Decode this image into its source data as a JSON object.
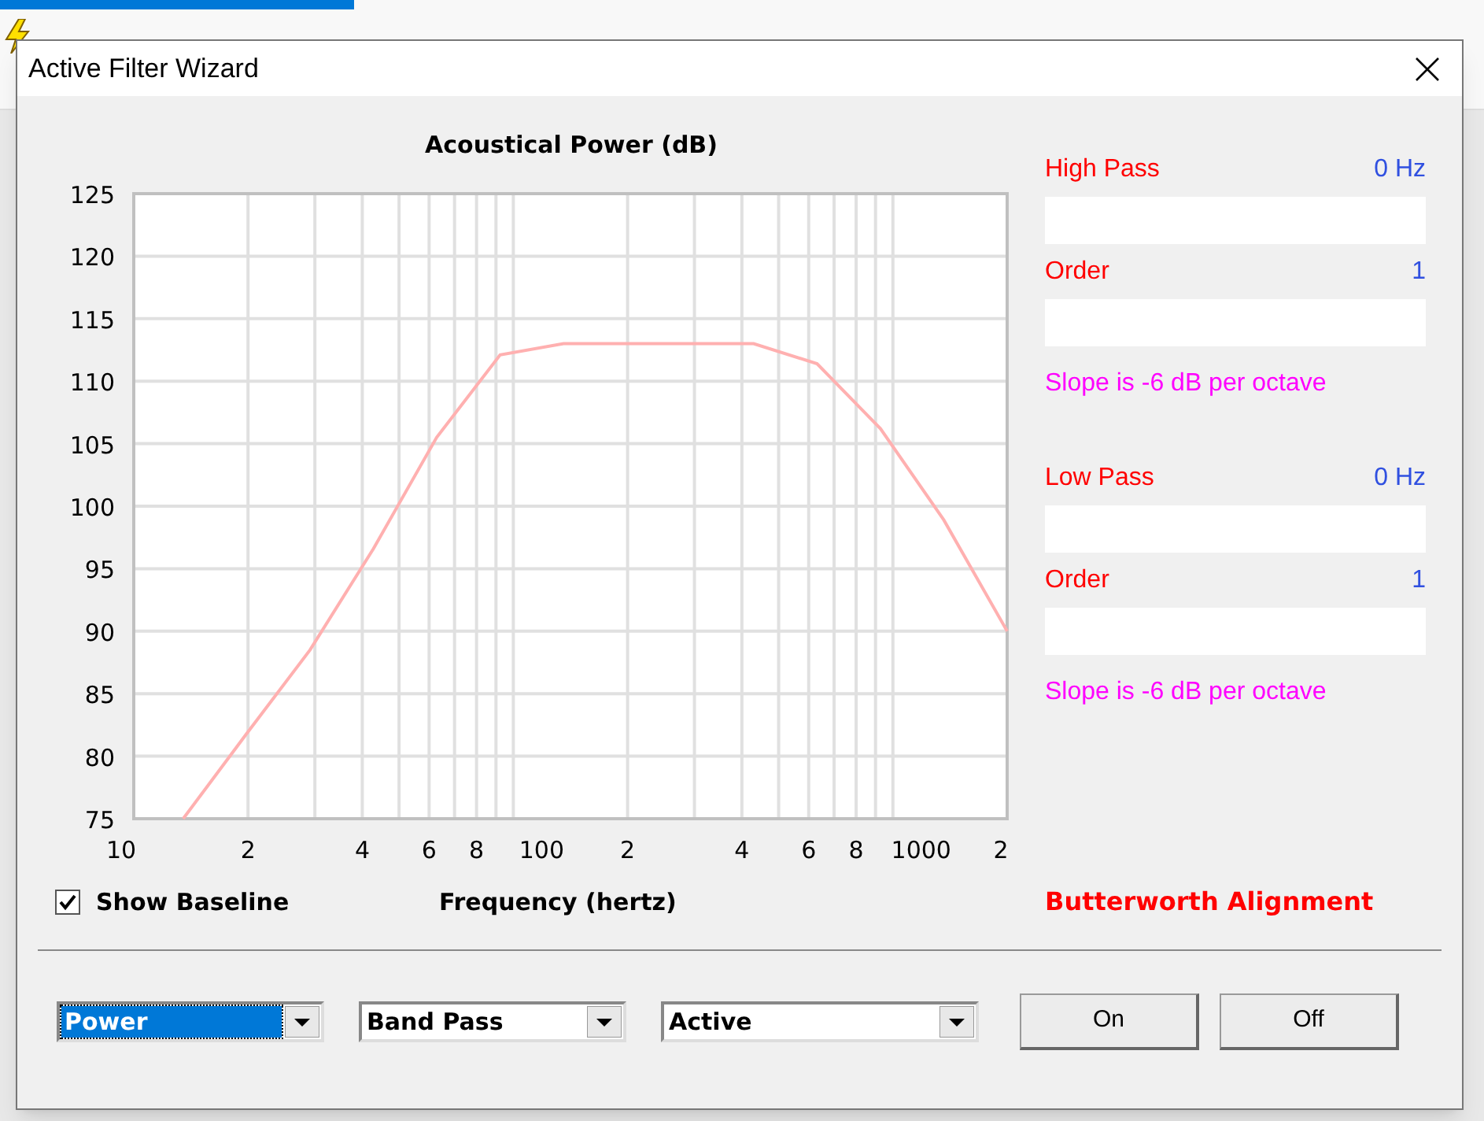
{
  "window": {
    "title": "Active Filter Wizard"
  },
  "chart": {
    "chart_data": {
      "type": "line",
      "title": "Acoustical Power (dB)",
      "xlabel": "Frequency (hertz)",
      "ylim": [
        75,
        125
      ],
      "grid": true,
      "yticks": [
        {
          "value": 75,
          "label": "75"
        },
        {
          "value": 80,
          "label": "80"
        },
        {
          "value": 85,
          "label": "85"
        },
        {
          "value": 90,
          "label": "90"
        },
        {
          "value": 95,
          "label": "95"
        },
        {
          "value": 100,
          "label": "100"
        },
        {
          "value": 105,
          "label": "105"
        },
        {
          "value": 110,
          "label": "110"
        },
        {
          "value": 115,
          "label": "115"
        },
        {
          "value": 120,
          "label": "120"
        },
        {
          "value": 125,
          "label": "125"
        }
      ],
      "categories": [
        null,
        null,
        null,
        null,
        null,
        null,
        null,
        null,
        null,
        null,
        null,
        null,
        null,
        null
      ],
      "series": [
        {
          "color": "#ffb0b0",
          "values": [
            75,
            81.8,
            88.5,
            96.6,
            105.5,
            112.1,
            113,
            113,
            113,
            113,
            111.4,
            106.2,
            98.9,
            90
          ]
        }
      ]
    },
    "x_axis_labels": [
      "10",
      "2",
      "4",
      "6",
      "8",
      "100",
      "2",
      "4",
      "6",
      "8",
      "1000",
      "2"
    ]
  },
  "show_baseline": {
    "label": "Show Baseline",
    "checked": true
  },
  "filters": [
    {
      "label": "High Pass",
      "value": "0 Hz",
      "order_label": "Order",
      "order_value": "1",
      "slope": "Slope is -6 dB per octave"
    },
    {
      "label": "Low Pass",
      "value": "0 Hz",
      "order_label": "Order",
      "order_value": "1",
      "slope": "Slope is -6 dB per octave"
    }
  ],
  "alignment": "Butterworth Alignment",
  "dropdowns": [
    {
      "value": "Power",
      "focused": true
    },
    {
      "value": "Band Pass",
      "focused": false
    },
    {
      "value": "Active",
      "focused": false
    }
  ],
  "buttons": [
    "On",
    "Off"
  ]
}
